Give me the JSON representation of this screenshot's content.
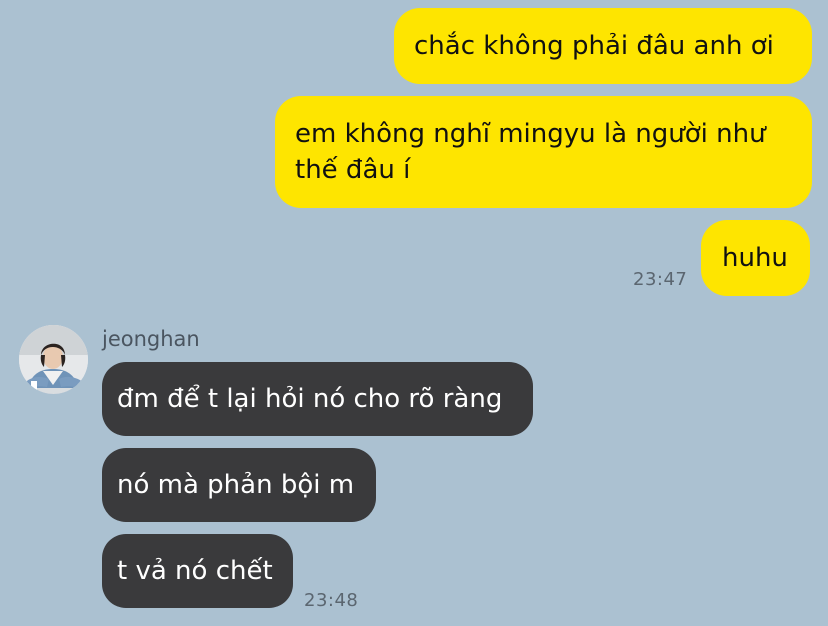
{
  "chat": {
    "outgoing": [
      {
        "lines": [
          "chắc không phải đâu anh ơi"
        ]
      },
      {
        "lines": [
          "em không nghĩ mingyu là người như",
          "thế đâu í"
        ]
      },
      {
        "lines": [
          "huhu"
        ]
      }
    ],
    "outgoing_time": "23:47",
    "sender": {
      "name": "jeonghan",
      "avatar": "profile-photo"
    },
    "incoming": [
      {
        "lines": [
          "đm để t lại hỏi nó cho rõ ràng"
        ]
      },
      {
        "lines": [
          "nó mà phản bội m"
        ]
      },
      {
        "lines": [
          "t vả nó chết"
        ]
      }
    ],
    "incoming_time": "23:48"
  },
  "colors": {
    "background": "#abc1d1",
    "outgoing_bubble": "#fee500",
    "incoming_bubble": "#3a3a3c"
  }
}
